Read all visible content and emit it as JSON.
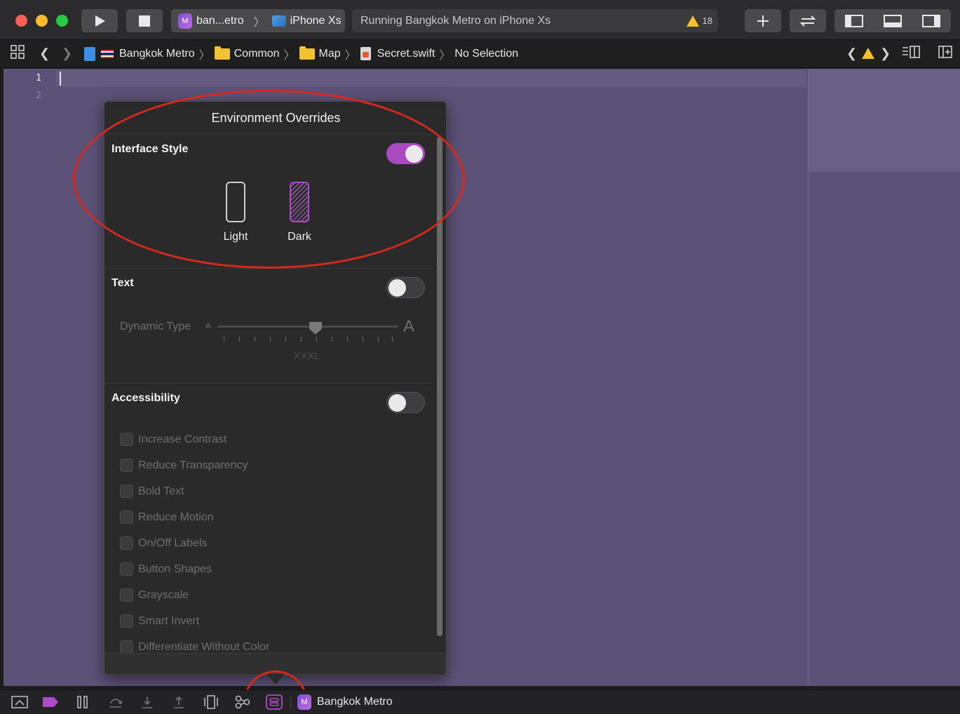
{
  "toolbar": {
    "scheme_name": "ban...etro",
    "device_name": "iPhone Xs",
    "status_text": "Running Bangkok Metro on iPhone Xs",
    "warning_count": "18"
  },
  "jumpbar": {
    "crumbs": [
      "Bangkok Metro",
      "Common",
      "Map",
      "Secret.swift",
      "No Selection"
    ]
  },
  "editor": {
    "line_numbers": [
      "1",
      "2"
    ]
  },
  "env_overrides": {
    "title": "Environment Overrides",
    "interface_style": {
      "title": "Interface Style",
      "enabled": true,
      "light_label": "Light",
      "dark_label": "Dark",
      "selected": "Dark"
    },
    "text": {
      "title": "Text",
      "enabled": false,
      "dynamic_type_label": "Dynamic Type",
      "size_small_glyph": "A",
      "size_large_glyph": "A",
      "selected_size": "XXXL"
    },
    "accessibility": {
      "title": "Accessibility",
      "enabled": false,
      "options": [
        "Increase Contrast",
        "Reduce Transparency",
        "Bold Text",
        "Reduce Motion",
        "On/Off Labels",
        "Button Shapes",
        "Grayscale",
        "Smart Invert",
        "Differentiate Without Color"
      ]
    }
  },
  "debugbar": {
    "target_name": "Bangkok Metro"
  },
  "colors": {
    "editor_bg": "#5c5277",
    "toggle_on": "#a94ac1",
    "annotation": "#d7281e",
    "warning": "#f4c32a"
  }
}
